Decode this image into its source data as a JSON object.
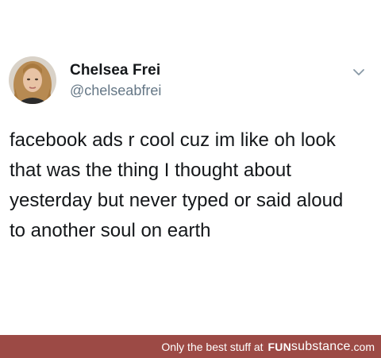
{
  "tweet": {
    "author_name": "Chelsea Frei",
    "author_handle": "@chelseabfrei",
    "text_lines": [
      "facebook ads r cool cuz im like oh look",
      "that was the thing I thought about",
      "yesterday but never typed or said aloud",
      "to another soul on earth"
    ],
    "avatar_icon": "avatar-photo",
    "menu_icon": "chevron-down-icon"
  },
  "footer": {
    "caption": "Only the best stuff at",
    "brand_bold": "FUN",
    "brand_rest": "substance",
    "brand_tld": ".com",
    "background_color": "#9c4a45"
  }
}
